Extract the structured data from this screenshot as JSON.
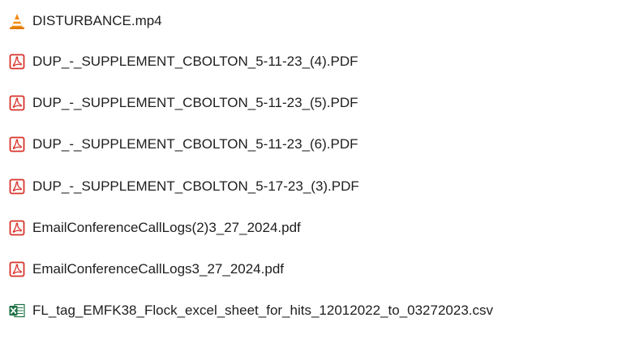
{
  "files": [
    {
      "name": "DISTURBANCE.mp4",
      "icon": "vlc-cone-icon"
    },
    {
      "name": "DUP_-_SUPPLEMENT_CBOLTON_5-11-23_(4).PDF",
      "icon": "pdf-icon"
    },
    {
      "name": "DUP_-_SUPPLEMENT_CBOLTON_5-11-23_(5).PDF",
      "icon": "pdf-icon"
    },
    {
      "name": "DUP_-_SUPPLEMENT_CBOLTON_5-11-23_(6).PDF",
      "icon": "pdf-icon"
    },
    {
      "name": "DUP_-_SUPPLEMENT_CBOLTON_5-17-23_(3).PDF",
      "icon": "pdf-icon"
    },
    {
      "name": "EmailConferenceCallLogs(2)3_27_2024.pdf",
      "icon": "pdf-icon"
    },
    {
      "name": "EmailConferenceCallLogs3_27_2024.pdf",
      "icon": "pdf-icon"
    },
    {
      "name": "FL_tag_EMFK38_Flock_excel_sheet_for_hits_12012022_to_03272023.csv",
      "icon": "excel-csv-icon"
    }
  ],
  "colors": {
    "pdf_red": "#d7332b",
    "vlc_orange": "#f28c13",
    "excel_green": "#1e7145",
    "text": "#1e1e1e"
  }
}
